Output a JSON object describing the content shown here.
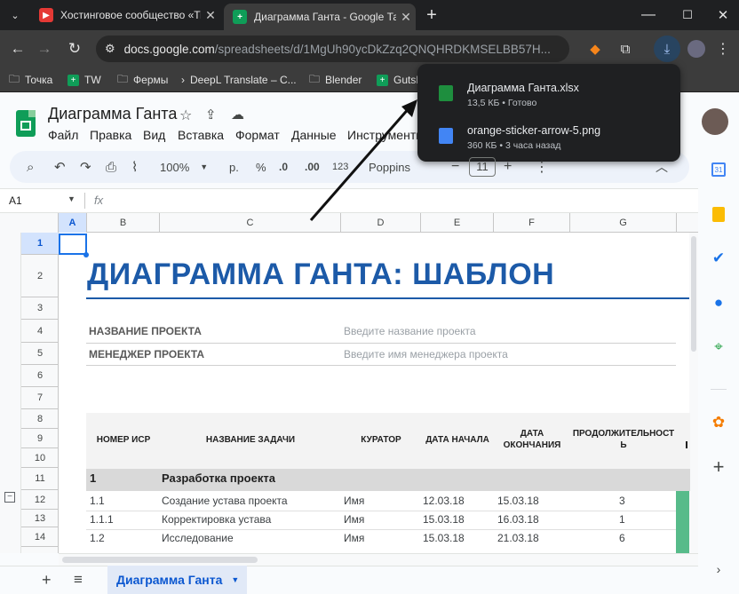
{
  "tabs": [
    {
      "title": "Хостинговое сообщество «Tim",
      "favicon_color": "#e53935",
      "active": false
    },
    {
      "title": "Диаграмма Ганта - Google Таб",
      "favicon_color": "#0f9d58",
      "active": true
    }
  ],
  "address": {
    "host": "docs.google.com",
    "path": "/spreadsheets/d/1MgUh90ycDkZzq2QNQHRDKMSELBB57H..."
  },
  "bookmarks": [
    {
      "label": "Точка",
      "icon": "folder"
    },
    {
      "label": "TW",
      "icon": "sheets"
    },
    {
      "label": "Фермы",
      "icon": "folder"
    },
    {
      "label": "DeepL Translate – C...",
      "icon": "deepl"
    },
    {
      "label": "Blender",
      "icon": "folder"
    },
    {
      "label": "Gutsh",
      "icon": "sheets"
    }
  ],
  "downloads": [
    {
      "name": "Диаграмма Ганта.xlsx",
      "status": "13,5 КБ • Готово",
      "icon_color": "#1e8e3e"
    },
    {
      "name": "orange-sticker-arrow-5.png",
      "status": "360 КБ • 3 часа назад",
      "icon_color": "#4285f4"
    }
  ],
  "doc": {
    "title": "Диаграмма Ганта",
    "menus": [
      "Файл",
      "Правка",
      "Вид",
      "Вставка",
      "Формат",
      "Данные",
      "Инструменты"
    ]
  },
  "format_bar": {
    "zoom": "100%",
    "currency": "р.",
    "percent": "%",
    "dec_minus": ".0",
    "dec_plus": ".00",
    "number_fmt": "123",
    "font": "Poppins",
    "font_size": "11"
  },
  "formula": {
    "cell_ref": "A1",
    "fx": "fx"
  },
  "columns": [
    "A",
    "B",
    "C",
    "D",
    "E",
    "F",
    "G"
  ],
  "rows": [
    "1",
    "2",
    "3",
    "4",
    "5",
    "6",
    "7",
    "8",
    "9",
    "10",
    "11",
    "12",
    "13",
    "14"
  ],
  "sheet": {
    "title": "ДИАГРАММА ГАНТА: ШАБЛОН",
    "project_name_label": "НАЗВАНИЕ ПРОЕКТА",
    "project_name_placeholder": "Введите название проекта",
    "manager_label": "МЕНЕДЖЕР ПРОЕКТА",
    "manager_placeholder": "Введите имя менеджера проекта",
    "headers": [
      "НОМЕР ИСР",
      "НАЗВАНИЕ ЗАДАЧИ",
      "КУРАТОР",
      "ДАТА НАЧАЛА",
      "ДАТА ОКОНЧАНИЯ",
      "ПРОДОЛЖИТЕЛЬНОСТЬ"
    ],
    "section": {
      "num": "1",
      "name": "Разработка проекта"
    },
    "tasks": [
      {
        "num": "1.1",
        "name": "Создание устава проекта",
        "owner": "Имя",
        "start": "12.03.18",
        "end": "15.03.18",
        "duration": "3"
      },
      {
        "num": "1.1.1",
        "name": "Корректировка устава",
        "owner": "Имя",
        "start": "15.03.18",
        "end": "16.03.18",
        "duration": "1"
      },
      {
        "num": "1.2",
        "name": "Исследование",
        "owner": "Имя",
        "start": "15.03.18",
        "end": "21.03.18",
        "duration": "6"
      }
    ]
  },
  "sheet_tab": "Диаграмма Ганта"
}
